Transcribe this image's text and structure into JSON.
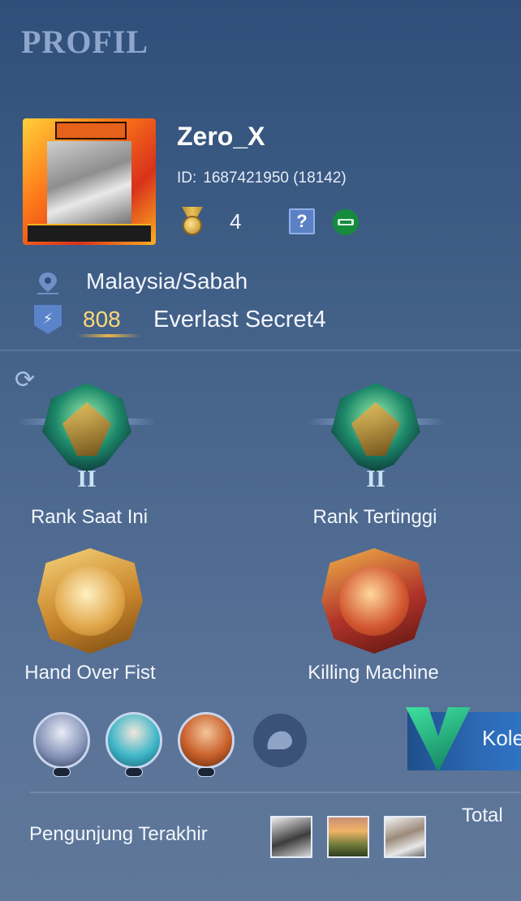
{
  "header": {
    "title": "PROFIL"
  },
  "profile": {
    "username": "Zero_X",
    "id_label": "ID:",
    "id_value": "1687421950 (18142)",
    "medal_count": "4",
    "unknown_badge": "?",
    "location": "Malaysia/Sabah",
    "squad_level": "808",
    "squad_name": "Everlast Secret4"
  },
  "ranks": {
    "current": {
      "label": "Rank Saat Ini",
      "tier": "II"
    },
    "highest": {
      "label": "Rank Tertinggi",
      "tier": "II"
    }
  },
  "achievements": [
    {
      "label": "Hand Over Fist",
      "color_outer": "#c9862c",
      "color_inner": "#f6d37a"
    },
    {
      "label": "Killing Machine",
      "color_outer": "#b0342a",
      "color_inner": "#f2b24a"
    }
  ],
  "collection": {
    "label": "Kole"
  },
  "visitors": {
    "label": "Pengunjung Terakhir"
  },
  "total": {
    "label": "Total"
  },
  "colors": {
    "accent": "#2b68b4",
    "gold": "#ffd978",
    "bg_top": "#2f4f7a",
    "bg_bottom": "#5f7899"
  }
}
